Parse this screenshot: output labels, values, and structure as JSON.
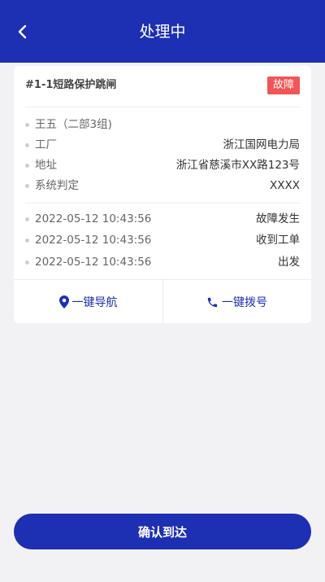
{
  "header": {
    "title": "处理中",
    "back_icon": "chevron-left-icon"
  },
  "card": {
    "title": "#1-1短路保护跳闸",
    "badge": "故障",
    "badge_color": "#f25555",
    "info": [
      {
        "label": "王五（二部3组)",
        "value": ""
      },
      {
        "label": "工厂",
        "value": "浙江国网电力局"
      },
      {
        "label": "地址",
        "value": "浙江省慈溪市XX路123号"
      },
      {
        "label": "系统判定",
        "value": "XXXX"
      }
    ],
    "timeline": [
      {
        "time": "2022-05-12 10:43:56",
        "event": "故障发生"
      },
      {
        "time": "2022-05-12 10:43:56",
        "event": "收到工单"
      },
      {
        "time": "2022-05-12 10:43:56",
        "event": "出发"
      }
    ],
    "actions": {
      "navigate": {
        "label": "一键导航",
        "icon": "location-pin-icon"
      },
      "call": {
        "label": "一键拨号",
        "icon": "phone-icon"
      }
    }
  },
  "footer": {
    "confirm_label": "确认到达"
  },
  "colors": {
    "primary": "#1d2fb3",
    "background": "#f2f2f4"
  }
}
